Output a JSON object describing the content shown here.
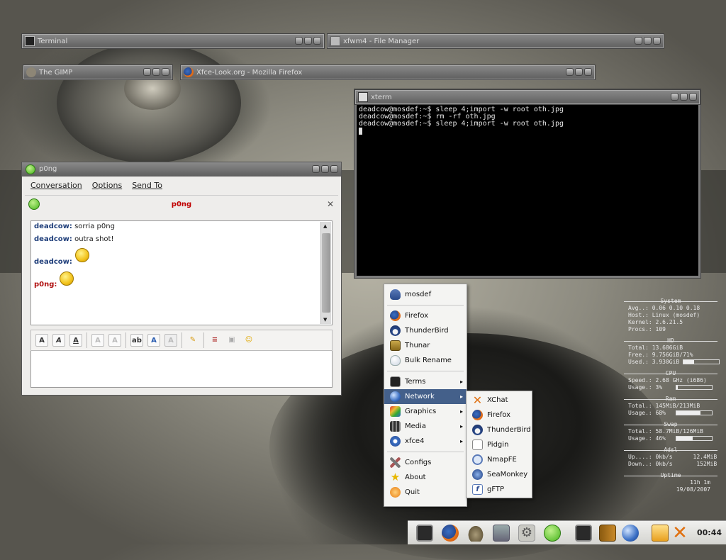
{
  "desktop": {
    "windows": [
      {
        "title": "Terminal"
      },
      {
        "title": "xfwm4 - File Manager"
      },
      {
        "title": "The GIMP"
      },
      {
        "title": "Xfce-Look.org - Mozilla Firefox"
      }
    ]
  },
  "xterm": {
    "title": "xterm",
    "lines": [
      "deadcow@mosdef:~$ sleep 4;import -w root oth.jpg",
      "deadcow@mosdef:~$ rm -rf oth.jpg",
      "deadcow@mosdef:~$ sleep 4;import -w root oth.jpg"
    ]
  },
  "chat": {
    "window_title": "p0ng",
    "menu": [
      "Conversation",
      "Options",
      "Send To"
    ],
    "buddy": "p0ng",
    "messages": [
      {
        "nick": "deadcow:",
        "text": "sorria p0ng"
      },
      {
        "nick": "deadcow:",
        "text": "outra shot!"
      },
      {
        "nick": "deadcow:",
        "text": ""
      },
      {
        "nick": "p0ng:",
        "text": ""
      }
    ],
    "format_buttons": [
      "A",
      "A",
      "A",
      "A",
      "A",
      "ab",
      "A",
      "A"
    ],
    "colors": {
      "self_nick": "#1f3e7a",
      "buddy_nick": "#b01010",
      "buddy_title": "#c00000"
    }
  },
  "menu": {
    "items": [
      {
        "label": "mosdef",
        "icon": "penguin-icon"
      },
      {
        "label": "Firefox",
        "icon": "firefox-icon"
      },
      {
        "label": "ThunderBird",
        "icon": "thunderbird-icon"
      },
      {
        "label": "Thunar",
        "icon": "thunar-icon"
      },
      {
        "label": "Bulk Rename",
        "icon": "bulb-icon"
      },
      {
        "label": "Terms",
        "icon": "terminal-icon"
      },
      {
        "label": "Network",
        "icon": "globe-icon"
      },
      {
        "label": "Graphics",
        "icon": "graphics-icon"
      },
      {
        "label": "Media",
        "icon": "film-icon"
      },
      {
        "label": "xfce4",
        "icon": "gear-icon"
      },
      {
        "label": "Configs",
        "icon": "tools-icon"
      },
      {
        "label": "About",
        "icon": "star-icon"
      },
      {
        "label": "Quit",
        "icon": "power-icon"
      }
    ],
    "submenu": [
      {
        "label": "XChat",
        "icon": "xchat-icon"
      },
      {
        "label": "Firefox",
        "icon": "firefox-icon"
      },
      {
        "label": "ThunderBird",
        "icon": "thunderbird-icon"
      },
      {
        "label": "Pidgin",
        "icon": "pidgin-icon"
      },
      {
        "label": "NmapFE",
        "icon": "magnifier-icon"
      },
      {
        "label": "SeaMonkey",
        "icon": "seamonkey-icon"
      },
      {
        "label": "gFTP",
        "icon": "gftp-icon"
      }
    ]
  },
  "conky": {
    "system": {
      "header": "System",
      "avg": "Avg..: 0.06 0.10 0.18",
      "host": "Host.: Linux (mosdef)",
      "kernel": "Kernel: 2.6.21.5",
      "procs": "Procs.: 109"
    },
    "hd": {
      "header": "HD",
      "total": "Total: 13.686GiB",
      "free": "Free.: 9.756GiB/71%",
      "used": "Used.: 3.930GiB",
      "used_fraction": 0.29
    },
    "cpu": {
      "header": "CPU",
      "speed": "Speed.: 2.68 GHz (i686)",
      "usage": "Usage.: 3%",
      "usage_fraction": 0.03
    },
    "ram": {
      "header": "Ram",
      "total": "Total.: 145MiB/213MiB",
      "usage": "Usage.: 68%",
      "usage_fraction": 0.68
    },
    "swap": {
      "header": "Swap",
      "total": "Total.: 58.7MiB/126MiB",
      "usage": "Usage.: 46%",
      "usage_fraction": 0.46
    },
    "adsl": {
      "header": "Adsl",
      "up": "Up....: 0kb/s      12.4MiB",
      "down": "Down..: 0kb/s       152MiB"
    },
    "uptime": {
      "header": "Uptime",
      "value": "11h 1m",
      "date": "19/08/2007"
    }
  },
  "panel": {
    "clock": "00:44",
    "launchers": [
      "terminal-icon",
      "firefox-icon",
      "gimp-icon",
      "folder-icon",
      "gear-icon",
      "pidgin-icon",
      "terminal-icon",
      "book-icon",
      "globe-icon",
      "chat-icon",
      "xchat-icon"
    ]
  }
}
